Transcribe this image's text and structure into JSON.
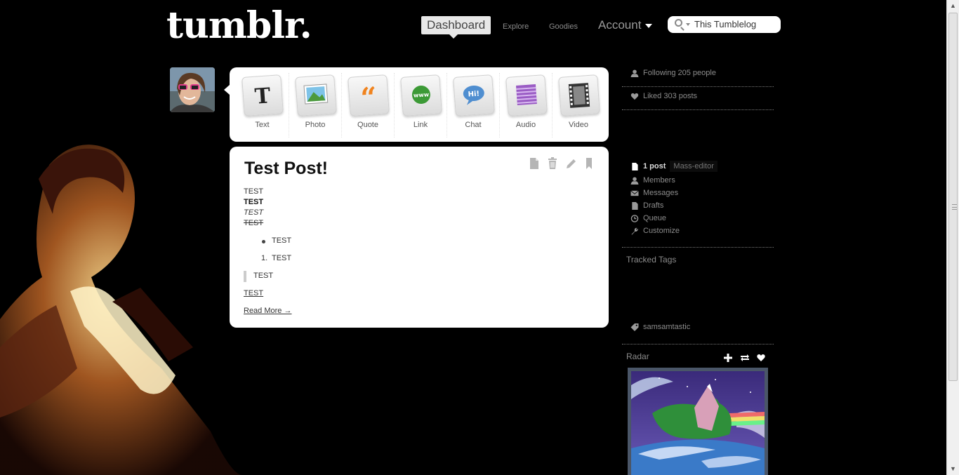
{
  "header": {
    "logo": "tumblr.",
    "nav": {
      "dashboard": "Dashboard",
      "explore": "Explore",
      "goodies": "Goodies",
      "account": "Account"
    },
    "search_label": "This Tumblelog"
  },
  "post_types": [
    {
      "label": "Text",
      "icon": "text-type-icon"
    },
    {
      "label": "Photo",
      "icon": "photo-type-icon"
    },
    {
      "label": "Quote",
      "icon": "quote-type-icon"
    },
    {
      "label": "Link",
      "icon": "link-type-icon"
    },
    {
      "label": "Chat",
      "icon": "chat-type-icon"
    },
    {
      "label": "Audio",
      "icon": "audio-type-icon"
    },
    {
      "label": "Video",
      "icon": "video-type-icon"
    }
  ],
  "post": {
    "title": "Test Post!",
    "lines": [
      "TEST",
      "TEST",
      "TEST",
      "TEST"
    ],
    "bullet_item": "TEST",
    "numbered_marker": "1.",
    "numbered_item": "TEST",
    "blockquote": "TEST",
    "underlined": "TEST",
    "read_more": "Read More →"
  },
  "sidebar": {
    "following": "Following 205 people",
    "liked": "Liked 303 posts",
    "posts_count": "1 post",
    "mass_editor": "Mass-editor",
    "members": "Members",
    "messages": "Messages",
    "drafts": "Drafts",
    "queue": "Queue",
    "customize": "Customize",
    "tracked_tags_title": "Tracked Tags",
    "tracked_tag": "samsamtastic",
    "radar_title": "Radar"
  },
  "colors": {
    "page_background": "#000000",
    "panel_background": "#ffffff",
    "sidebar_text": "#8c8c8c",
    "dashboard_tab": "#e8e8e8"
  }
}
